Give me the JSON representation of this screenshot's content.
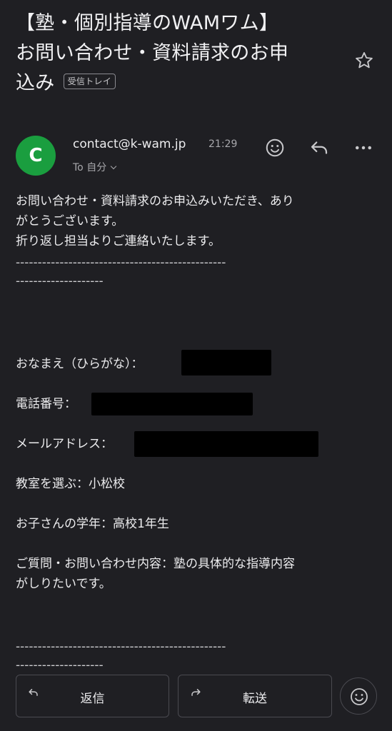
{
  "email": {
    "subject_lines": [
      "【塾・個別指導のWAMワム】",
      "お問い合わせ・資料請求のお申",
      "込み"
    ],
    "label": "受信トレイ",
    "sender": {
      "avatar_letter": "C",
      "address": "contact@k-wam.jp",
      "time": "21:29",
      "to": "To 自分"
    },
    "body": {
      "intro": [
        "お問い合わせ・資料請求のお申込みいただき、あり",
        "がとうございます。",
        "折り返し担当よりご連絡いたします。"
      ],
      "separator_1": "------------------------------------------------",
      "separator_2": "--------------------",
      "fields": {
        "name_label": "おなまえ（ひらがな）：",
        "phone_label": "電話番号：",
        "email_label": "メールアドレス：",
        "classroom": "教室を選ぶ：小松校",
        "grade": "お子さんの学年：高校1年生",
        "inquiry_1": "ご質問・お問い合わせ内容：塾の具体的な指導内容",
        "inquiry_2": "がしりたいです。"
      },
      "separator_3": "------------------------------------------------",
      "separator_4": "--------------------"
    }
  },
  "actions": {
    "reply_label": "返信",
    "forward_label": "転送"
  },
  "colors": {
    "background": "#1f1f23",
    "avatar": "#1a9e3f",
    "text": "#ececee",
    "muted": "#a8a8ac"
  },
  "icons": [
    "star-icon",
    "emoji-icon",
    "reply-icon",
    "more-icon",
    "chevron-down-icon",
    "forward-icon"
  ]
}
